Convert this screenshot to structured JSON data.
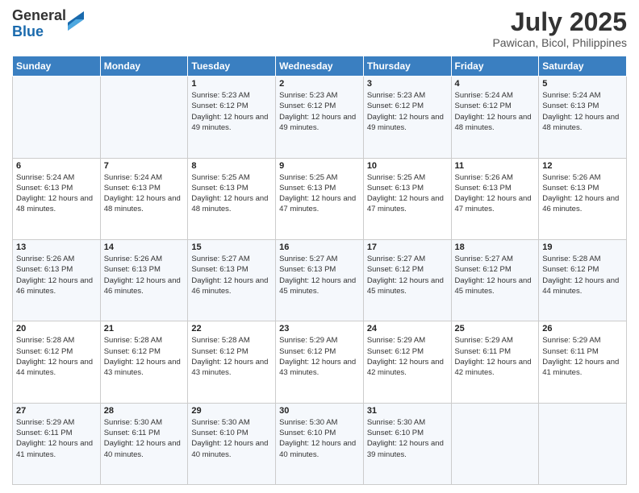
{
  "header": {
    "logo_general": "General",
    "logo_blue": "Blue",
    "month_year": "July 2025",
    "location": "Pawican, Bicol, Philippines"
  },
  "weekdays": [
    "Sunday",
    "Monday",
    "Tuesday",
    "Wednesday",
    "Thursday",
    "Friday",
    "Saturday"
  ],
  "weeks": [
    [
      {
        "day": "",
        "info": ""
      },
      {
        "day": "",
        "info": ""
      },
      {
        "day": "1",
        "info": "Sunrise: 5:23 AM\nSunset: 6:12 PM\nDaylight: 12 hours and 49 minutes."
      },
      {
        "day": "2",
        "info": "Sunrise: 5:23 AM\nSunset: 6:12 PM\nDaylight: 12 hours and 49 minutes."
      },
      {
        "day": "3",
        "info": "Sunrise: 5:23 AM\nSunset: 6:12 PM\nDaylight: 12 hours and 49 minutes."
      },
      {
        "day": "4",
        "info": "Sunrise: 5:24 AM\nSunset: 6:12 PM\nDaylight: 12 hours and 48 minutes."
      },
      {
        "day": "5",
        "info": "Sunrise: 5:24 AM\nSunset: 6:13 PM\nDaylight: 12 hours and 48 minutes."
      }
    ],
    [
      {
        "day": "6",
        "info": "Sunrise: 5:24 AM\nSunset: 6:13 PM\nDaylight: 12 hours and 48 minutes."
      },
      {
        "day": "7",
        "info": "Sunrise: 5:24 AM\nSunset: 6:13 PM\nDaylight: 12 hours and 48 minutes."
      },
      {
        "day": "8",
        "info": "Sunrise: 5:25 AM\nSunset: 6:13 PM\nDaylight: 12 hours and 48 minutes."
      },
      {
        "day": "9",
        "info": "Sunrise: 5:25 AM\nSunset: 6:13 PM\nDaylight: 12 hours and 47 minutes."
      },
      {
        "day": "10",
        "info": "Sunrise: 5:25 AM\nSunset: 6:13 PM\nDaylight: 12 hours and 47 minutes."
      },
      {
        "day": "11",
        "info": "Sunrise: 5:26 AM\nSunset: 6:13 PM\nDaylight: 12 hours and 47 minutes."
      },
      {
        "day": "12",
        "info": "Sunrise: 5:26 AM\nSunset: 6:13 PM\nDaylight: 12 hours and 46 minutes."
      }
    ],
    [
      {
        "day": "13",
        "info": "Sunrise: 5:26 AM\nSunset: 6:13 PM\nDaylight: 12 hours and 46 minutes."
      },
      {
        "day": "14",
        "info": "Sunrise: 5:26 AM\nSunset: 6:13 PM\nDaylight: 12 hours and 46 minutes."
      },
      {
        "day": "15",
        "info": "Sunrise: 5:27 AM\nSunset: 6:13 PM\nDaylight: 12 hours and 46 minutes."
      },
      {
        "day": "16",
        "info": "Sunrise: 5:27 AM\nSunset: 6:13 PM\nDaylight: 12 hours and 45 minutes."
      },
      {
        "day": "17",
        "info": "Sunrise: 5:27 AM\nSunset: 6:12 PM\nDaylight: 12 hours and 45 minutes."
      },
      {
        "day": "18",
        "info": "Sunrise: 5:27 AM\nSunset: 6:12 PM\nDaylight: 12 hours and 45 minutes."
      },
      {
        "day": "19",
        "info": "Sunrise: 5:28 AM\nSunset: 6:12 PM\nDaylight: 12 hours and 44 minutes."
      }
    ],
    [
      {
        "day": "20",
        "info": "Sunrise: 5:28 AM\nSunset: 6:12 PM\nDaylight: 12 hours and 44 minutes."
      },
      {
        "day": "21",
        "info": "Sunrise: 5:28 AM\nSunset: 6:12 PM\nDaylight: 12 hours and 43 minutes."
      },
      {
        "day": "22",
        "info": "Sunrise: 5:28 AM\nSunset: 6:12 PM\nDaylight: 12 hours and 43 minutes."
      },
      {
        "day": "23",
        "info": "Sunrise: 5:29 AM\nSunset: 6:12 PM\nDaylight: 12 hours and 43 minutes."
      },
      {
        "day": "24",
        "info": "Sunrise: 5:29 AM\nSunset: 6:12 PM\nDaylight: 12 hours and 42 minutes."
      },
      {
        "day": "25",
        "info": "Sunrise: 5:29 AM\nSunset: 6:11 PM\nDaylight: 12 hours and 42 minutes."
      },
      {
        "day": "26",
        "info": "Sunrise: 5:29 AM\nSunset: 6:11 PM\nDaylight: 12 hours and 41 minutes."
      }
    ],
    [
      {
        "day": "27",
        "info": "Sunrise: 5:29 AM\nSunset: 6:11 PM\nDaylight: 12 hours and 41 minutes."
      },
      {
        "day": "28",
        "info": "Sunrise: 5:30 AM\nSunset: 6:11 PM\nDaylight: 12 hours and 40 minutes."
      },
      {
        "day": "29",
        "info": "Sunrise: 5:30 AM\nSunset: 6:10 PM\nDaylight: 12 hours and 40 minutes."
      },
      {
        "day": "30",
        "info": "Sunrise: 5:30 AM\nSunset: 6:10 PM\nDaylight: 12 hours and 40 minutes."
      },
      {
        "day": "31",
        "info": "Sunrise: 5:30 AM\nSunset: 6:10 PM\nDaylight: 12 hours and 39 minutes."
      },
      {
        "day": "",
        "info": ""
      },
      {
        "day": "",
        "info": ""
      }
    ]
  ]
}
